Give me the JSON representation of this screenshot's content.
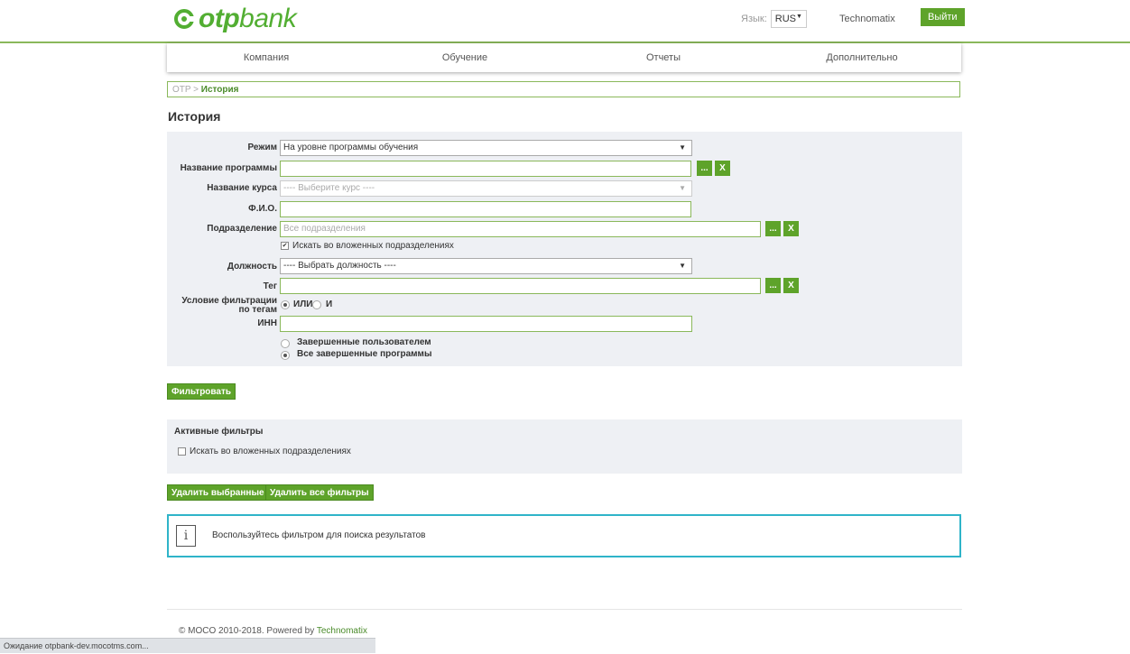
{
  "header": {
    "logo_bold": "otp",
    "logo_light": "bank",
    "lang_label": "Язык:",
    "lang_value": "RUS",
    "user": "Technomatix",
    "logout": "Выйти"
  },
  "nav": [
    "Компания",
    "Обучение",
    "Отчеты",
    "Дополнительно"
  ],
  "breadcrumb": {
    "root": "OTP",
    "sep": ">",
    "current": "История"
  },
  "page_title": "История",
  "filters": {
    "mode_label": "Режим",
    "mode_value": "На уровне программы обучения",
    "program_label": "Название программы",
    "course_label": "Название курса",
    "course_placeholder": "---- Выберите курс ----",
    "fio_label": "Ф.И.О.",
    "dept_label": "Подразделение",
    "dept_placeholder": "Все подразделения",
    "nested_check": "Искать во вложенных подразделениях",
    "position_label": "Должность",
    "position_value": "---- Выбрать должность ----",
    "tag_label": "Тег",
    "tag_cond_label_1": "Условие фильтрации",
    "tag_cond_label_2": "по тегам",
    "or_label": "ИЛИ",
    "and_label": "И",
    "inn_label": "ИНН",
    "completed_user": "Завершенные пользователем",
    "completed_all": "Все завершенные программы",
    "browse": "...",
    "clear": "X"
  },
  "filter_button": "Фильтровать",
  "active_filters": {
    "title": "Активные фильтры",
    "item": "Искать во вложенных подразделениях"
  },
  "delete_selected": "Удалить выбранные",
  "delete_all": "Удалить все фильтры",
  "info": {
    "icon": "i",
    "text": "Воспользуйтесь фильтром для поиска результатов"
  },
  "footer": {
    "copy": "© MOCO 2010-2018. Powered by",
    "brand": "Technomatix"
  },
  "status_bar": "Ожидание otpbank-dev.mocotms.com..."
}
